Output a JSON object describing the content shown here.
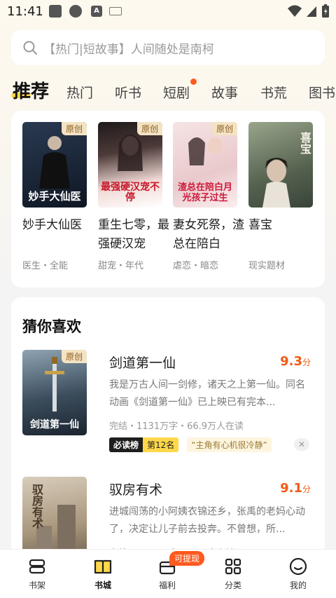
{
  "status_bar": {
    "time": "11:41",
    "a_icon": "A"
  },
  "search": {
    "placeholder": "【热门|短故事】人间随处是南柯"
  },
  "tabs": {
    "active": "推荐",
    "items": [
      "热门",
      "听书",
      "短剧",
      "故事",
      "书荒",
      "图书"
    ]
  },
  "recommend": {
    "books": [
      {
        "title": "妙手大仙医",
        "sub": "医生・全能",
        "tag": "原创",
        "cover_text": "妙手大仙医",
        "cover_color": "#1d2a3c"
      },
      {
        "title": "重生七零，最强硬汉宠",
        "sub": "甜宠・年代",
        "tag": "原创",
        "cover_text": "最强硬汉宠不停",
        "cover_color": "#e8d4c8"
      },
      {
        "title": "妻女死祭，渣总在陪白",
        "sub": "虐恋・暗恋",
        "tag": "原创",
        "cover_text": "渣总在陪白月光孩子过生",
        "cover_color": "#f3dede"
      },
      {
        "title": "喜宝",
        "sub": "现实题材",
        "tag": "",
        "cover_text": "喜宝",
        "cover_color": "#6c7a64"
      }
    ]
  },
  "guess": {
    "header": "猜你喜欢",
    "items": [
      {
        "title": "剑道第一仙",
        "score": "9.3",
        "score_unit": "分",
        "desc": "我是万古人间一剑修，诸天之上第一仙。同名动画《剑道第一仙》已上映已有完本...",
        "meta": "完结・1131万字・66.9万人在读",
        "rank_label": "必读榜",
        "rank_pos": "第12名",
        "quote": "“主角有心机很冷静”",
        "tag": "原创",
        "cover_text": "剑道第一仙",
        "cover_color": "#3b4d5c"
      },
      {
        "title": "驭房有术",
        "score": "9.1",
        "score_unit": "分",
        "desc": "进城闯荡的小阿姨衣锦还乡，张禹的老妈心动了，决定让儿子前去投奔。不曾想，所...",
        "meta": "完结・1149万字・21万人在读",
        "tag": "",
        "cover_text": "驭房有术",
        "cover_color": "#b9a68c"
      }
    ]
  },
  "bottom_nav": {
    "items": [
      {
        "label": "书架",
        "icon": "bookshelf-icon"
      },
      {
        "label": "书城",
        "icon": "book-city-icon"
      },
      {
        "label": "福利",
        "icon": "gift-icon"
      },
      {
        "label": "分类",
        "icon": "category-icon"
      },
      {
        "label": "我的",
        "icon": "profile-icon"
      }
    ],
    "active": "书城",
    "badge": "可提现"
  },
  "colors": {
    "accent": "#ffd84a",
    "score": "#f05a14",
    "badge": "#ff5a1f"
  }
}
